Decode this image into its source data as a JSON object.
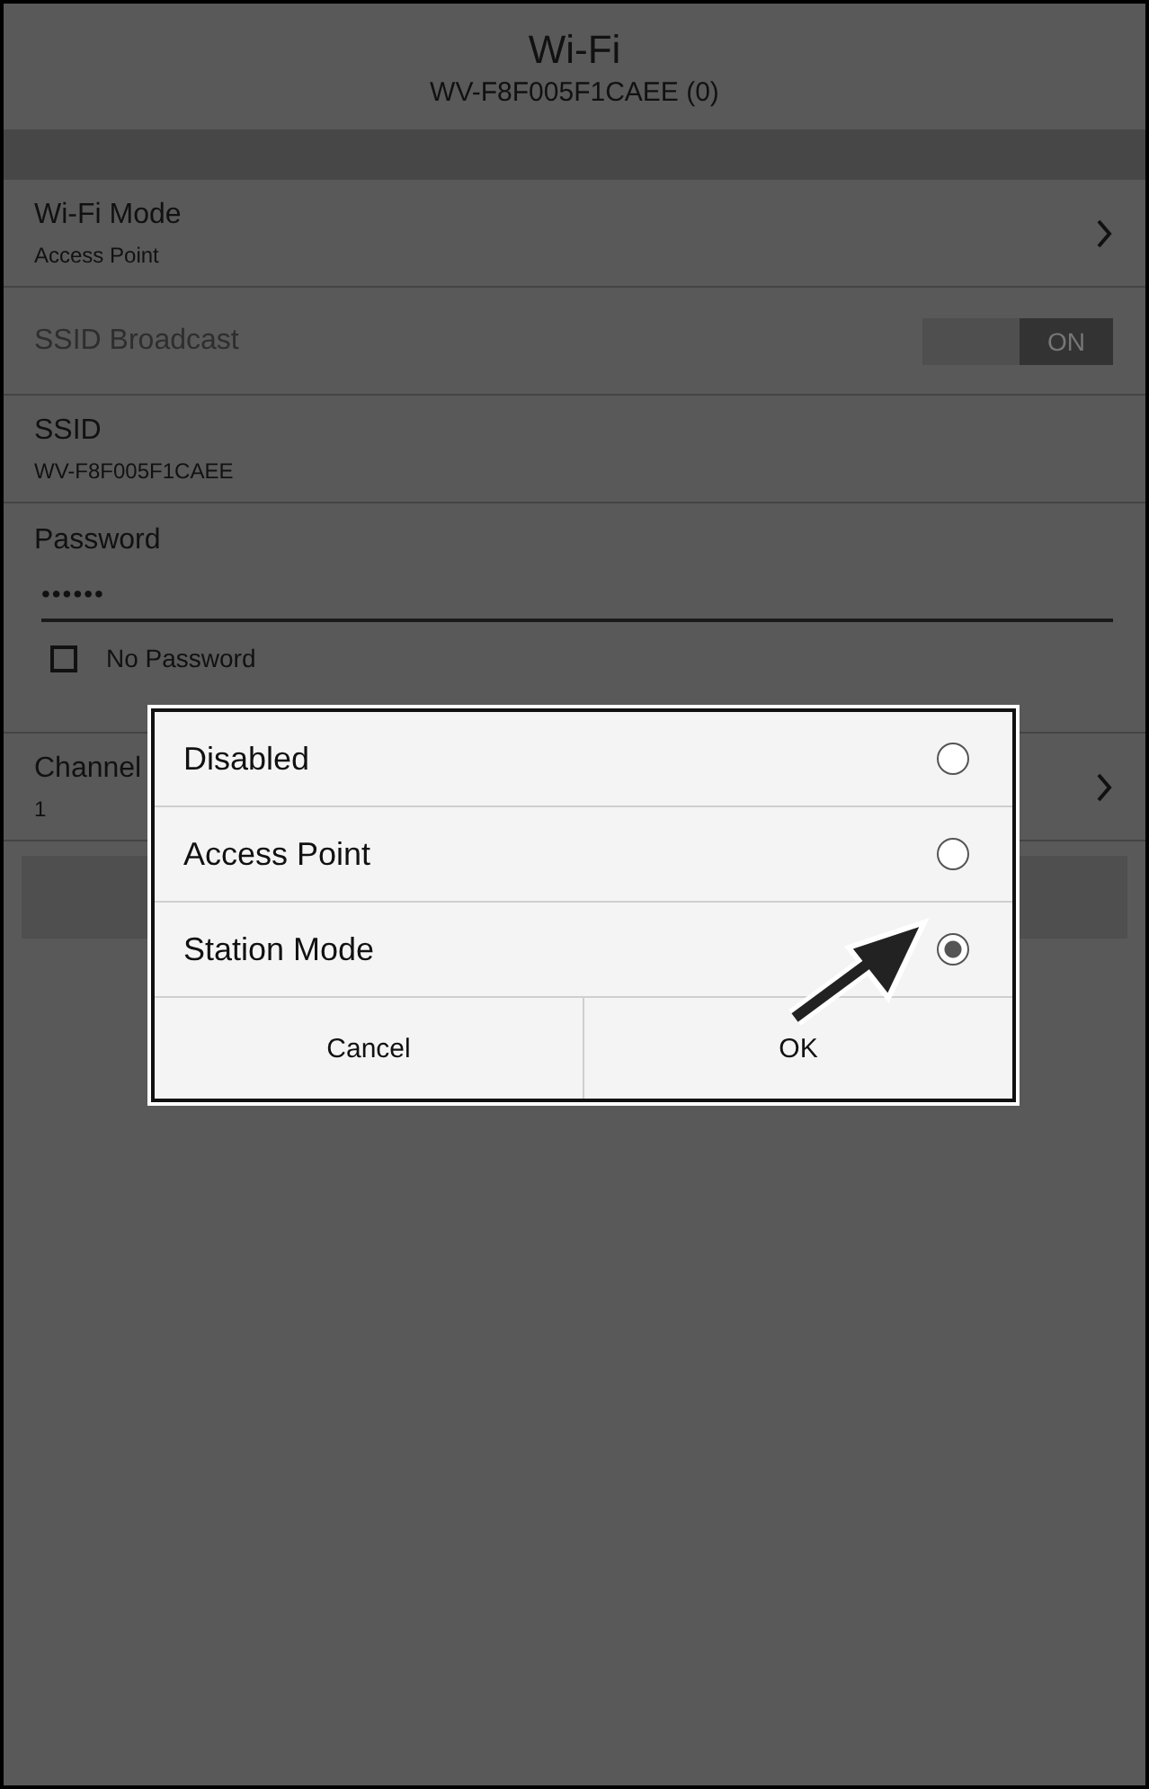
{
  "header": {
    "title": "Wi-Fi",
    "subtitle": "WV-F8F005F1CAEE (0)"
  },
  "settings": [
    {
      "kind": "link",
      "label": "Wi-Fi Mode",
      "value": "Access Point"
    },
    {
      "kind": "toggle",
      "label": "SSID Broadcast",
      "disabled": true,
      "on": true,
      "toggle_text": "ON"
    },
    {
      "kind": "text",
      "label": "SSID",
      "value": "WV-F8F005F1CAEE"
    },
    {
      "kind": "password",
      "label": "Password",
      "value": "••••••",
      "checkbox": {
        "label": "No Password",
        "checked": false
      }
    },
    {
      "kind": "link",
      "label": "Channel",
      "value": "1"
    }
  ],
  "dialog": {
    "options": [
      {
        "label": "Disabled",
        "selected": false
      },
      {
        "label": "Access Point",
        "selected": false
      },
      {
        "label": "Station Mode",
        "selected": true
      }
    ],
    "buttons": [
      "Cancel",
      "OK"
    ]
  }
}
